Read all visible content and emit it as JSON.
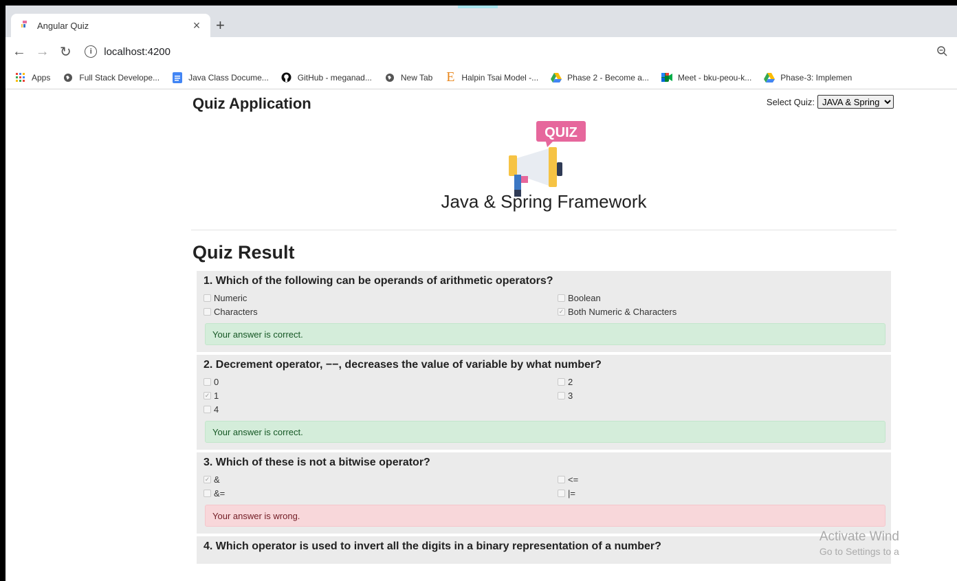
{
  "browser": {
    "tab_title": "Angular Quiz",
    "tab_close": "×",
    "new_tab": "+",
    "url": "localhost:4200",
    "bookmarks": [
      {
        "label": "Apps",
        "icon": "apps-grid-icon"
      },
      {
        "label": "Full Stack Develope...",
        "icon": "globe-icon"
      },
      {
        "label": "Java Class Docume...",
        "icon": "docs-icon"
      },
      {
        "label": "GitHub - meganad...",
        "icon": "github-icon"
      },
      {
        "label": "New Tab",
        "icon": "globe-icon"
      },
      {
        "label": "Halpin Tsai Model -...",
        "icon": "e-logo-icon"
      },
      {
        "label": "Phase 2 - Become a...",
        "icon": "drive-icon"
      },
      {
        "label": "Meet - bku-peou-k...",
        "icon": "meet-icon"
      },
      {
        "label": "Phase-3: Implemen",
        "icon": "drive-icon"
      }
    ]
  },
  "app": {
    "title": "Quiz Application",
    "select_label": "Select Quiz:",
    "select_value": "JAVA & Spring",
    "logo_text": "QUIZ",
    "quiz_name": "Java & Spring Framework",
    "result_heading": "Quiz Result"
  },
  "questions": [
    {
      "text": "1. Which of the following can be operands of arithmetic operators?",
      "options": [
        {
          "label": "Numeric",
          "checked": false
        },
        {
          "label": "Boolean",
          "checked": false
        },
        {
          "label": "Characters",
          "checked": false
        },
        {
          "label": "Both Numeric & Characters",
          "checked": true
        }
      ],
      "result": "Your answer is correct.",
      "correct": true
    },
    {
      "text": "2. Decrement operator, −−, decreases the value of variable by what number?",
      "options": [
        {
          "label": "0",
          "checked": false
        },
        {
          "label": "2",
          "checked": false
        },
        {
          "label": "1",
          "checked": true
        },
        {
          "label": "3",
          "checked": false
        },
        {
          "label": "4",
          "checked": false
        }
      ],
      "result": "Your answer is correct.",
      "correct": true
    },
    {
      "text": "3. Which of these is not a bitwise operator?",
      "options": [
        {
          "label": "&",
          "checked": true
        },
        {
          "label": "<=",
          "checked": false
        },
        {
          "label": "&=",
          "checked": false
        },
        {
          "label": "|=",
          "checked": false
        }
      ],
      "result": "Your answer is wrong.",
      "correct": false
    },
    {
      "text": "4. Which operator is used to invert all the digits in a binary representation of a number?",
      "options": [],
      "result": "",
      "correct": null
    }
  ],
  "watermark": {
    "line1": "Activate Wind",
    "line2": "Go to Settings to a"
  },
  "colors": {
    "correct_bg": "#d4edda",
    "wrong_bg": "#f8d7da",
    "card_bg": "#ebebeb"
  }
}
